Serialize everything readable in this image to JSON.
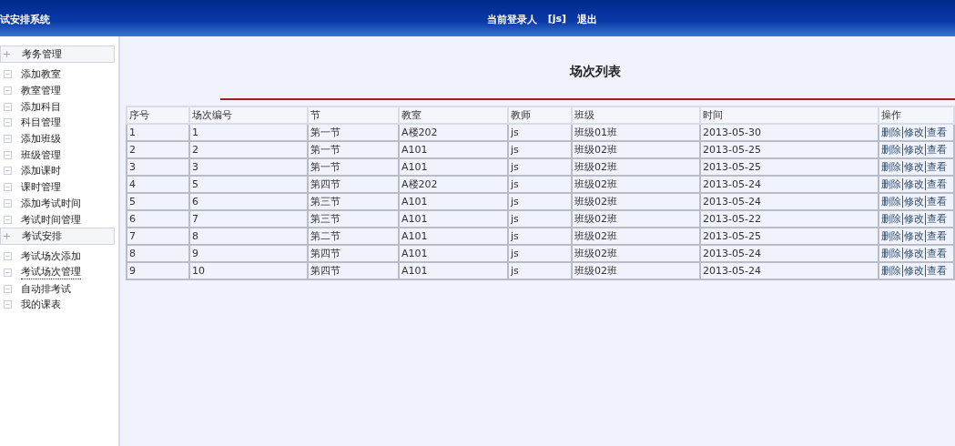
{
  "header": {
    "title": "试安排系统",
    "login_label": "当前登录人",
    "user": "[js]",
    "logout": "退出"
  },
  "sidebar": {
    "sections": [
      {
        "title": "考务管理",
        "items": [
          {
            "label": "添加教室",
            "selected": false
          },
          {
            "label": "教室管理",
            "selected": false
          },
          {
            "label": "添加科目",
            "selected": false
          },
          {
            "label": "科目管理",
            "selected": false
          },
          {
            "label": "添加班级",
            "selected": false
          },
          {
            "label": "班级管理",
            "selected": false
          },
          {
            "label": "添加课时",
            "selected": false
          },
          {
            "label": "课时管理",
            "selected": false
          },
          {
            "label": "添加考试时间",
            "selected": false
          },
          {
            "label": "考试时间管理",
            "selected": false
          }
        ]
      },
      {
        "title": "考试安排",
        "items": [
          {
            "label": "考试场次添加",
            "selected": false
          },
          {
            "label": "考试场次管理",
            "selected": true
          },
          {
            "label": "自动排考试",
            "selected": false
          },
          {
            "label": "我的课表",
            "selected": false
          }
        ]
      }
    ]
  },
  "page_title": "场次列表",
  "table": {
    "columns": [
      "序号",
      "场次编号",
      "节",
      "教室",
      "教师",
      "班级",
      "时间",
      "操作"
    ],
    "rows": [
      {
        "cells": [
          "1",
          "1",
          "第一节",
          "A楼202",
          "js",
          "班级01班",
          "2013-05-30"
        ],
        "actions": [
          "删除",
          "修改",
          "查看"
        ]
      },
      {
        "cells": [
          "2",
          "2",
          "第一节",
          "A101",
          "js",
          "班级02班",
          "2013-05-25"
        ],
        "actions": [
          "删除",
          "修改",
          "查看"
        ]
      },
      {
        "cells": [
          "3",
          "3",
          "第一节",
          "A101",
          "js",
          "班级02班",
          "2013-05-25"
        ],
        "actions": [
          "删除",
          "修改",
          "查看"
        ]
      },
      {
        "cells": [
          "4",
          "5",
          "第四节",
          "A楼202",
          "js",
          "班级02班",
          "2013-05-24"
        ],
        "actions": [
          "删除",
          "修改",
          "查看"
        ]
      },
      {
        "cells": [
          "5",
          "6",
          "第三节",
          "A101",
          "js",
          "班级02班",
          "2013-05-24"
        ],
        "actions": [
          "删除",
          "修改",
          "查看"
        ]
      },
      {
        "cells": [
          "6",
          "7",
          "第三节",
          "A101",
          "js",
          "班级02班",
          "2013-05-22"
        ],
        "actions": [
          "删除",
          "修改",
          "查看"
        ]
      },
      {
        "cells": [
          "7",
          "8",
          "第二节",
          "A101",
          "js",
          "班级02班",
          "2013-05-25"
        ],
        "actions": [
          "删除",
          "修改",
          "查看"
        ]
      },
      {
        "cells": [
          "8",
          "9",
          "第四节",
          "A101",
          "js",
          "班级02班",
          "2013-05-24"
        ],
        "actions": [
          "删除",
          "修改",
          "查看"
        ]
      },
      {
        "cells": [
          "9",
          "10",
          "第四节",
          "A101",
          "js",
          "班级02班",
          "2013-05-24"
        ],
        "actions": [
          "删除",
          "修改",
          "查看"
        ]
      }
    ]
  }
}
